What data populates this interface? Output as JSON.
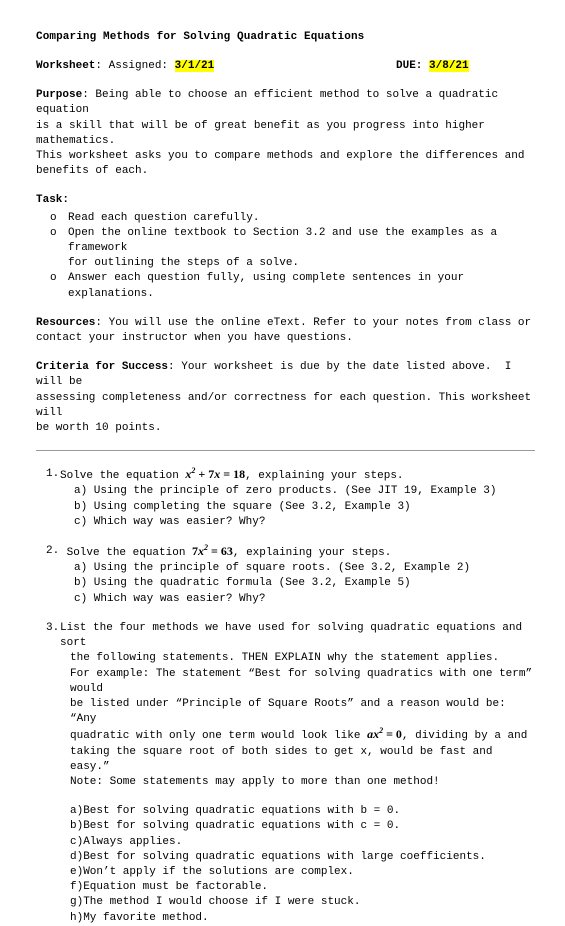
{
  "document": {
    "title": "Comparing Methods for Solving Quadratic Equations",
    "worksheet_label": "Worksheet",
    "assigned_label": "Assigned:",
    "assigned_date": "3/1/21",
    "due_label": "DUE:",
    "due_date": "3/8/21",
    "highlight_color": "#ffff00"
  },
  "purpose": {
    "label": "Purpose",
    "text": " Being able to choose an efficient method to solve a quadratic equation\nis a skill that will be of great benefit as you progress into higher mathematics.\nThis worksheet asks you to compare methods and explore the differences and\nbenefits of each."
  },
  "task": {
    "label": "Task:",
    "marker": "o",
    "items": [
      "Read each question carefully.",
      "Open the online textbook to Section 3.2 and use the examples as a framework\nfor outlining the steps of a solve.",
      "Answer each question fully, using complete sentences in your explanations."
    ]
  },
  "resources": {
    "label": "Resources",
    "text": " You will use the online eText. Refer to your notes from class or\ncontact your instructor when you have questions."
  },
  "criteria": {
    "label": "Criteria for Success",
    "text": " Your worksheet is due by the date listed above.  I will be\nassessing completeness and/or correctness for each question. This worksheet will\nbe worth 10 points."
  },
  "questions": [
    {
      "number": "1.",
      "text_before": "Solve the equation ",
      "equation": {
        "base1": "x",
        "exp1": "2",
        "mid": " + 7",
        "base2": "x",
        "op": " = ",
        "value": "18"
      },
      "text_after": ", explaining your steps.",
      "subitems": [
        "a) Using the principle of zero products. (See JIT 19, Example 3)",
        "b) Using completing the square (See 3.2, Example 3)",
        "c) Which way was easier? Why?"
      ]
    },
    {
      "number": "2.",
      "text_before": " Solve the equation ",
      "equation": {
        "coef": "7",
        "base1": "x",
        "exp1": "2",
        "op": " = ",
        "value": "63"
      },
      "text_after": ", explaining your steps.",
      "subitems": [
        "a) Using the principle of square roots. (See 3.2, Example 2)",
        "b) Using the quadratic formula (See 3.2, Example 5)",
        "c) Which way was easier? Why?"
      ]
    }
  ],
  "question3": {
    "number": "3.",
    "line1": "List the four methods we have used for solving quadratic equations and sort",
    "line2": "the following statements. THEN EXPLAIN why the statement applies.",
    "line3": "For example: The statement “Best for solving quadratics with one term” would",
    "line4": "be listed under “Principle of Square Roots” and a reason would be: “Any",
    "line5_before": "quadratic with only one term would look like ",
    "equation": {
      "coef": "a",
      "base1": "x",
      "exp1": "2",
      "op": " = ",
      "value": "0"
    },
    "line5_after": ", dividing by a and",
    "line6": "taking the square root of both sides to get x, would be fast and easy.”",
    "line7": "Note: Some statements may apply to more than one method!",
    "lettered_items": [
      "a)Best for solving quadratic equations with b = 0.",
      "b)Best for solving quadratic equations with c = 0.",
      "c)Always applies.",
      "d)Best for solving quadratic equations with large coefficients.",
      "e)Won’t apply if the solutions are complex.",
      "f)Equation must be factorable.",
      "g)The method I would choose if I were stuck.",
      "h)My favorite method."
    ]
  }
}
